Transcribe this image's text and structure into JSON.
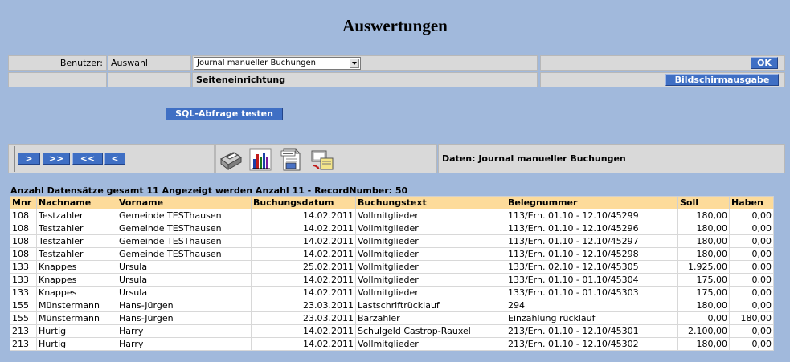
{
  "page": {
    "title": "Auswertungen"
  },
  "form": {
    "benutzer_label": "Benutzer:",
    "auswahl_label": "Auswahl",
    "report_select": "Journal manueller Buchungen",
    "ok_label": "OK",
    "seiteneinrichtung_label": "Seiteneinrichtung",
    "bildschirm_label": "Bildschirmausgabe",
    "sql_label": "SQL-Abfrage testen"
  },
  "nav": {
    "next": ">",
    "last": ">>",
    "first": "<<",
    "prev": "<",
    "icons": [
      "printer-icon",
      "chart-icon",
      "office-document-icon",
      "export-icon"
    ],
    "data_label": "Daten: Journal manueller Buchungen"
  },
  "summary": "Anzahl Datensätze gesamt 11 Angezeigt werden Anzahl 11 - RecordNumber: 50",
  "table": {
    "headers": [
      "Mnr",
      "Nachname",
      "Vorname",
      "Buchungsdatum",
      "Buchungstext",
      "Belegnummer",
      "Soll",
      "Haben"
    ],
    "rows": [
      [
        "108",
        "Testzahler",
        "Gemeinde TESThausen",
        "14.02.2011",
        "Vollmitglieder",
        "113/Erh. 01.10 - 12.10/45299",
        "180,00",
        "0,00"
      ],
      [
        "108",
        "Testzahler",
        "Gemeinde TESThausen",
        "14.02.2011",
        "Vollmitglieder",
        "113/Erh. 01.10 - 12.10/45296",
        "180,00",
        "0,00"
      ],
      [
        "108",
        "Testzahler",
        "Gemeinde TESThausen",
        "14.02.2011",
        "Vollmitglieder",
        "113/Erh. 01.10 - 12.10/45297",
        "180,00",
        "0,00"
      ],
      [
        "108",
        "Testzahler",
        "Gemeinde TESThausen",
        "14.02.2011",
        "Vollmitglieder",
        "113/Erh. 01.10 - 12.10/45298",
        "180,00",
        "0,00"
      ],
      [
        "133",
        "Knappes",
        "Ursula",
        "25.02.2011",
        "Vollmitglieder",
        "133/Erh. 02.10 - 12.10/45305",
        "1.925,00",
        "0,00"
      ],
      [
        "133",
        "Knappes",
        "Ursula",
        "14.02.2011",
        "Vollmitglieder",
        "133/Erh. 01.10 - 01.10/45304",
        "175,00",
        "0,00"
      ],
      [
        "133",
        "Knappes",
        "Ursula",
        "14.02.2011",
        "Vollmitglieder",
        "133/Erh. 01.10 - 01.10/45303",
        "175,00",
        "0,00"
      ],
      [
        "155",
        "Münstermann",
        "Hans-Jürgen",
        "23.03.2011",
        "Lastschriftrücklauf",
        "294",
        "180,00",
        "0,00"
      ],
      [
        "155",
        "Münstermann",
        "Hans-Jürgen",
        "23.03.2011",
        "Barzahler",
        "Einzahlung rücklauf",
        "0,00",
        "180,00"
      ],
      [
        "213",
        "Hurtig",
        "Harry",
        "14.02.2011",
        "Schulgeld Castrop-Rauxel",
        "213/Erh. 01.10 - 12.10/45301",
        "2.100,00",
        "0,00"
      ],
      [
        "213",
        "Hurtig",
        "Harry",
        "14.02.2011",
        "Vollmitglieder",
        "213/Erh. 01.10 - 12.10/45302",
        "180,00",
        "0,00"
      ]
    ]
  }
}
